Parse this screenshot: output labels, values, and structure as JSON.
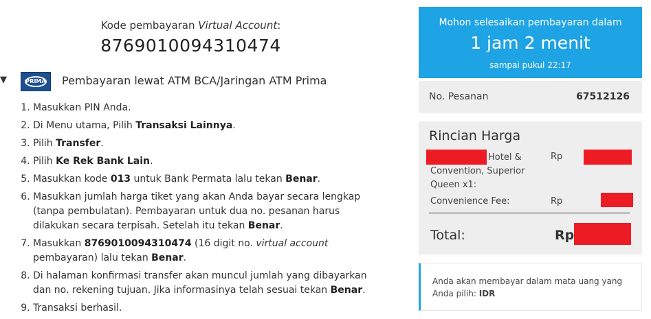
{
  "va": {
    "label_prefix": "Kode pembayaran ",
    "label_italic": "Virtual Account",
    "label_suffix": ":",
    "number": "8769010094310474"
  },
  "section": {
    "caret": "▼",
    "logo_text": "PRIMA",
    "title": "Pembayaran lewat ATM BCA/Jaringan ATM Prima"
  },
  "steps": [
    {
      "parts": [
        {
          "t": "Masukkan PIN Anda."
        }
      ]
    },
    {
      "parts": [
        {
          "t": "Di Menu utama, Pilih "
        },
        {
          "t": "Transaksi Lainnya",
          "b": true
        },
        {
          "t": "."
        }
      ]
    },
    {
      "parts": [
        {
          "t": "Pilih "
        },
        {
          "t": "Transfer",
          "b": true
        },
        {
          "t": "."
        }
      ]
    },
    {
      "parts": [
        {
          "t": "Pilih "
        },
        {
          "t": "Ke Rek Bank Lain",
          "b": true
        },
        {
          "t": "."
        }
      ]
    },
    {
      "parts": [
        {
          "t": "Masukkan kode "
        },
        {
          "t": "013",
          "b": true
        },
        {
          "t": " untuk Bank Permata lalu tekan "
        },
        {
          "t": "Benar",
          "b": true
        },
        {
          "t": "."
        }
      ]
    },
    {
      "parts": [
        {
          "t": "Masukkan jumlah harga tiket yang akan Anda bayar secara lengkap (tanpa pembulatan). Pembayaran untuk dua no. pesanan harus dilakukan secara terpisah. Setelah itu tekan "
        },
        {
          "t": "Benar",
          "b": true
        },
        {
          "t": "."
        }
      ]
    },
    {
      "parts": [
        {
          "t": "Masukkan "
        },
        {
          "t": "8769010094310474",
          "b": true
        },
        {
          "t": " (16 digit no. "
        },
        {
          "t": "virtual account",
          "i": true
        },
        {
          "t": " pembayaran) lalu tekan "
        },
        {
          "t": "Benar",
          "b": true
        },
        {
          "t": "."
        }
      ]
    },
    {
      "parts": [
        {
          "t": "Di halaman konfirmasi transfer akan muncul jumlah yang dibayarkan dan no. rekening tujuan. Jika informasinya telah sesuai tekan "
        },
        {
          "t": "Benar",
          "b": true
        },
        {
          "t": "."
        }
      ]
    },
    {
      "parts": [
        {
          "t": "Transaksi berhasil."
        }
      ]
    }
  ],
  "timer": {
    "line1": "Mohon selesaikan pembayaran dalam",
    "countdown": "1 jam 2 menit",
    "until": "sampai pukul 22:17",
    "bg_color": "#1ea3e4"
  },
  "order": {
    "label": "No. Pesanan",
    "number": "67512126"
  },
  "price": {
    "title": "Rincian Harga",
    "hotel_item": "Hotel & Convention, Superior Queen x1:",
    "currency": "Rp",
    "fee_label": "Convenience Fee:",
    "total_label": "Total:",
    "redaction_color": "#ed1c24"
  },
  "info": {
    "text": "Anda akan membayar dalam mata uang yang Anda pilih: ",
    "currency_code": "IDR"
  }
}
